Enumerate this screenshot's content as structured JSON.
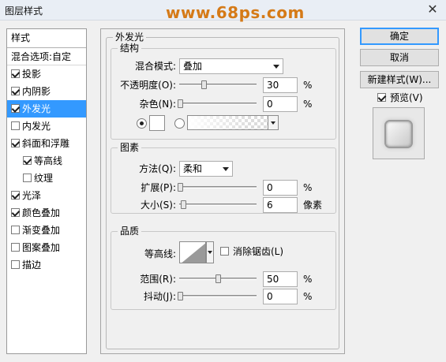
{
  "window": {
    "title": "图层样式",
    "watermark": "www.68ps.com"
  },
  "sidebar": {
    "header": "样式",
    "blend": "混合选项:自定",
    "items": [
      {
        "label": "投影",
        "checked": true
      },
      {
        "label": "内阴影",
        "checked": true
      },
      {
        "label": "外发光",
        "checked": true,
        "selected": true
      },
      {
        "label": "内发光",
        "checked": false
      },
      {
        "label": "斜面和浮雕",
        "checked": true
      },
      {
        "label": "等高线",
        "checked": true,
        "sub": true
      },
      {
        "label": "纹理",
        "checked": false,
        "sub": true
      },
      {
        "label": "光泽",
        "checked": true
      },
      {
        "label": "颜色叠加",
        "checked": true
      },
      {
        "label": "渐变叠加",
        "checked": false
      },
      {
        "label": "图案叠加",
        "checked": false
      },
      {
        "label": "描边",
        "checked": false
      }
    ]
  },
  "outer_glow": {
    "title": "外发光",
    "structure": {
      "title": "结构",
      "blend_mode_label": "混合模式:",
      "blend_mode": "叠加",
      "opacity_label": "不透明度(O):",
      "opacity": "30",
      "opacity_unit": "%",
      "noise_label": "杂色(N):",
      "noise": "0",
      "noise_unit": "%",
      "color_mode": "solid"
    },
    "elements": {
      "title": "图素",
      "method_label": "方法(Q):",
      "method": "柔和",
      "spread_label": "扩展(P):",
      "spread": "0",
      "spread_unit": "%",
      "size_label": "大小(S):",
      "size": "6",
      "size_unit": "像素"
    },
    "quality": {
      "title": "品质",
      "contour_label": "等高线:",
      "antialias_label": "消除锯齿(L)",
      "antialias": false,
      "range_label": "范围(R):",
      "range": "50",
      "range_unit": "%",
      "jitter_label": "抖动(J):",
      "jitter": "0",
      "jitter_unit": "%"
    }
  },
  "buttons": {
    "ok": "确定",
    "cancel": "取消",
    "new_style": "新建样式(W)..."
  },
  "preview": {
    "label": "预览(V)",
    "checked": true
  },
  "colors": {
    "selection": "#3399ff",
    "watermark": "#d57a17"
  }
}
